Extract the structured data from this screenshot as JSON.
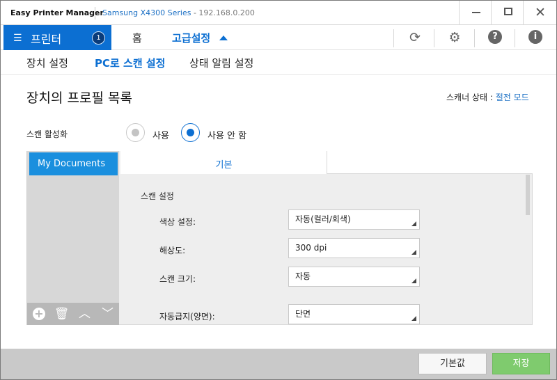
{
  "window": {
    "app_title": "Easy Printer Manager",
    "device_name": "Samsung X4300 Series",
    "device_ip": " - 192.168.0.200",
    "minimize_icon": "minimize-icon",
    "maximize_icon": "maximize-icon",
    "close_glyph": "✕"
  },
  "nav": {
    "printer_label": "프린터",
    "printer_count": "1",
    "home_label": "홈",
    "advanced_label": "고급설정",
    "icons": [
      "refresh-icon",
      "gear-icon",
      "help-icon",
      "info-icon"
    ],
    "refresh_glyph": "⟳",
    "gear_glyph": "⚙",
    "help_glyph": "?",
    "info_glyph": "i",
    "accent_color": "#0c6fd2"
  },
  "subtabs": {
    "device_settings": "장치 설정",
    "pc_scan_settings": "PC로 스캔 설정",
    "status_alert_settings": "상태 알림 설정"
  },
  "page": {
    "title": "장치의 프로필 목록",
    "scanner_status_label": "스캐너 상태 : ",
    "scanner_status_value": "절전 모드",
    "scan_activation_label": "스캔 활성화",
    "radio_use": "사용",
    "radio_not_use": "사용 안 함",
    "selected_option": "사용 안 함"
  },
  "profiles": {
    "items": [
      "My Documents"
    ],
    "toolbar_glyphs": {
      "add": "+",
      "delete": "🗑",
      "up": "︿",
      "down": "﹀"
    }
  },
  "settings": {
    "tab_basic": "기본",
    "section_title": "스캔 설정",
    "fields": [
      {
        "label": "색상 설정:",
        "value": "자동(컬러/회색)"
      },
      {
        "label": "해상도:",
        "value": "300 dpi"
      },
      {
        "label": "스캔 크기:",
        "value": "자동"
      },
      {
        "label": "자동급지(양면):",
        "value": "단면"
      }
    ]
  },
  "footer": {
    "default_label": "기본값",
    "save_label": "저장",
    "save_color": "#7fcb6e"
  }
}
